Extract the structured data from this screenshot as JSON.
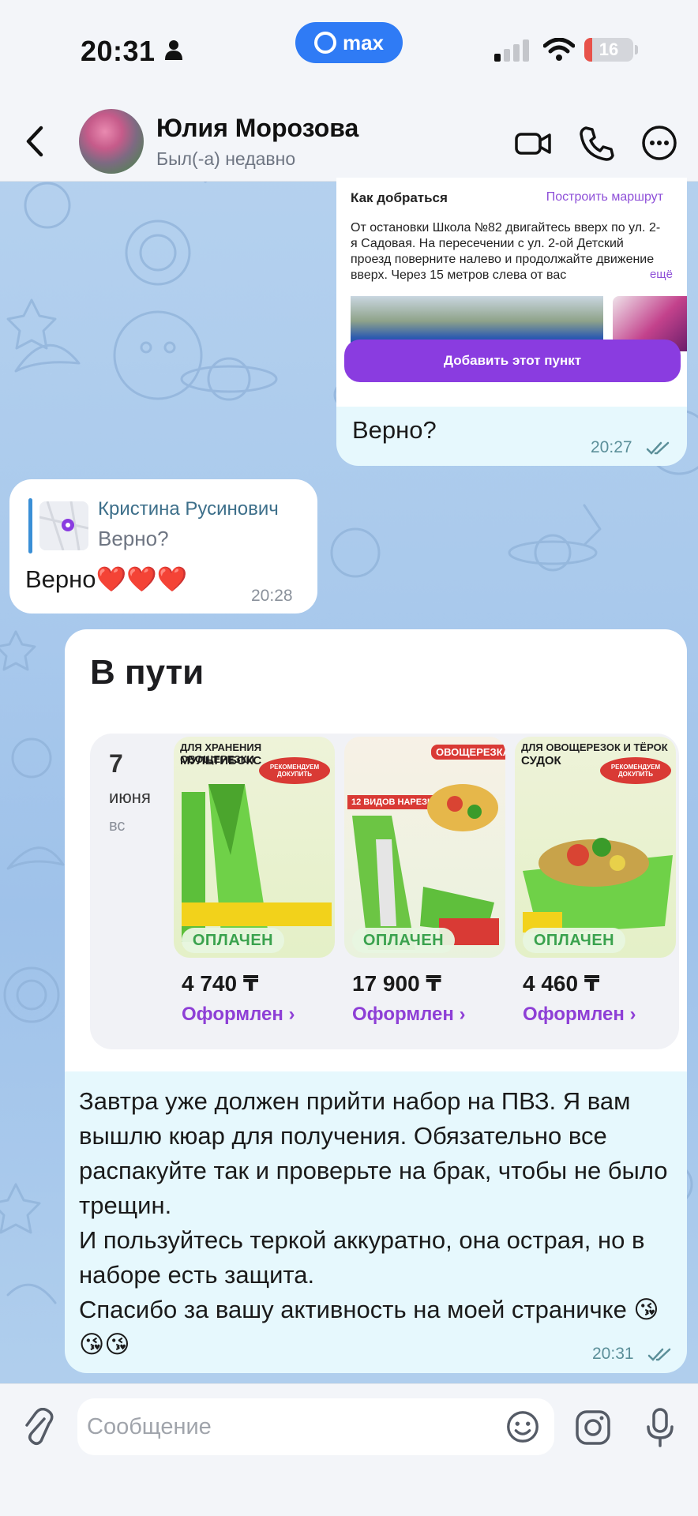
{
  "status_bar": {
    "time": "20:31",
    "app_badge": "max",
    "battery_level": 16,
    "battery_color": "#e8524a"
  },
  "header": {
    "contact_name": "Юлия Морозова",
    "contact_status": "Был(-а) недавно",
    "icons": [
      "back-icon",
      "video-call-icon",
      "phone-icon",
      "more-icon"
    ]
  },
  "messages": {
    "location": {
      "title": "Как добраться",
      "route_link": "Построить маршрут",
      "directions": "От остановки  Школа №82 двигайтесь вверх по ул. 2-я Садовая. На пересечении с ул. 2-ой Детский проезд поверните налево и продолжайте движение вверх. Через 15 метров слева от вас",
      "more_link": "ещё",
      "add_button": "Добавить этот пункт",
      "text": "Верно?",
      "time": "20:27"
    },
    "reply": {
      "quoted_author": "Кристина Русинович",
      "quoted_text": "Верно?",
      "text": "Верно❤️❤️❤️",
      "time": "20:28"
    },
    "order": {
      "title": "В пути",
      "date_day": "7",
      "date_month": "июня",
      "date_weekday": "вс",
      "products": [
        {
          "top_label": "ДЛЯ ХРАНЕНИЯ ОВОЩЕРЕЗКИ",
          "name": "МУЛЬТИБОКС",
          "badge": "РЕКОМЕНДУЕМ ДОКУПИТЬ",
          "paid": "ОПЛАЧЕН",
          "price": "4 740 ₸",
          "status": "Оформлен ›"
        },
        {
          "top_label": "",
          "name": "ОВОЩЕРЕЗКА",
          "badge": "12 ВИДОВ НАРЕЗКИ",
          "paid": "ОПЛАЧЕН",
          "price": "17 900 ₸",
          "status": "Оформлен ›"
        },
        {
          "top_label": "ДЛЯ ОВОЩЕРЕЗОК И ТЁРОК",
          "name": "СУДОК",
          "badge": "РЕКОМЕНДУЕМ ДОКУПИТЬ",
          "paid": "ОПЛАЧЕН",
          "price": "4 460 ₸",
          "status": "Оформлен ›"
        }
      ],
      "text": "Завтра уже должен прийти набор на ПВЗ. Я вам вышлю кюар для получения. Обязательно все распакуйте так и проверьте на брак, чтобы не было трещин.\nИ пользуйтесь теркой аккуратно, она острая, но в наборе есть защита.\nСпасибо за вашу активность на моей страничке 😘😘😘",
      "time": "20:31"
    }
  },
  "composer": {
    "placeholder": "Сообщение",
    "value": "",
    "icons": [
      "attach-icon",
      "emoji-icon",
      "camera-icon",
      "microphone-icon"
    ]
  },
  "colors": {
    "accent": "#2f7bf5",
    "purple_action": "#8a3ce0",
    "paid_green": "#3aa24e",
    "status_purple": "#8e3fd6",
    "outgoing_bubble": "#e6f8fd",
    "incoming_bubble": "#ffffff"
  }
}
